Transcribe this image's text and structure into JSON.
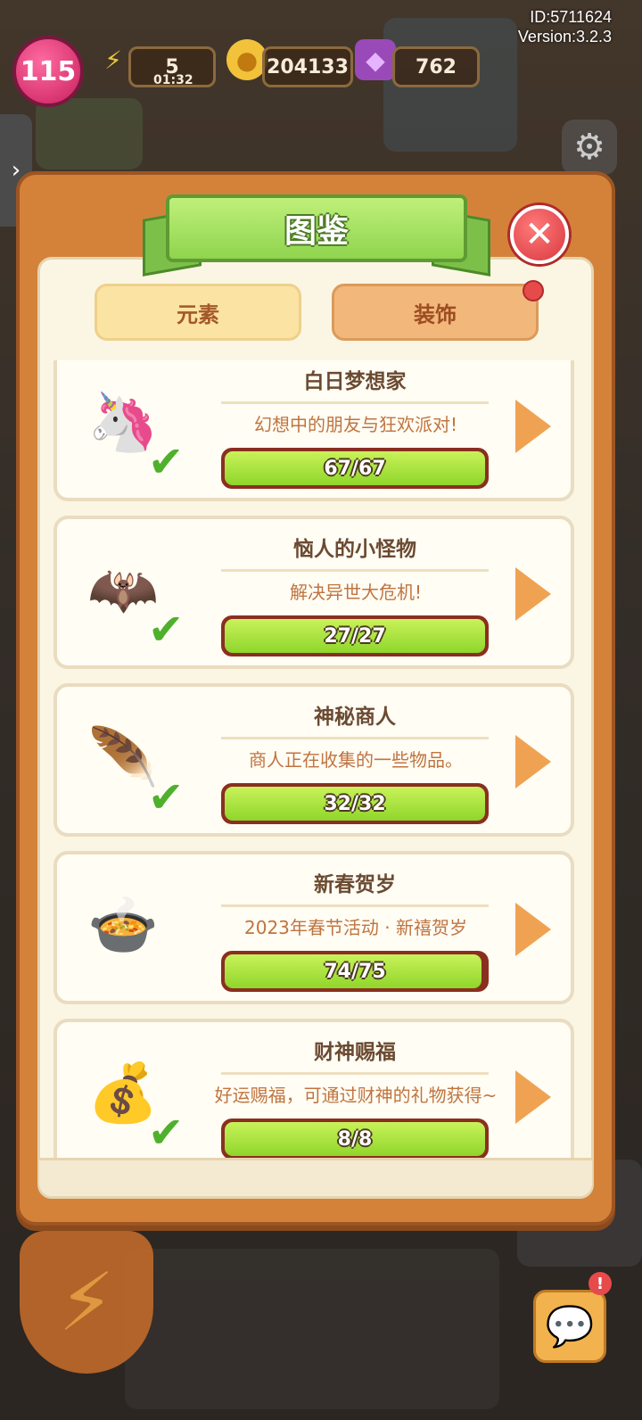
{
  "hud": {
    "id_text": "ID:5711624",
    "version_text": "Version:3.2.3",
    "level": "115",
    "energy": "5",
    "energy_timer": "01:32",
    "coins": "204133",
    "gems": "762"
  },
  "side_tab_icon": "chevron-right-icon",
  "panel": {
    "title": "图鉴",
    "close_icon": "close-icon",
    "tabs": [
      {
        "label": "元素"
      },
      {
        "label": "装饰"
      }
    ]
  },
  "collections": [
    {
      "title": "白日梦想家",
      "desc": "幻想中的朋友与狂欢派对!",
      "progress": "67/67",
      "fraction": 1.0,
      "complete": true,
      "icon": "unicorn-icon"
    },
    {
      "title": "恼人的小怪物",
      "desc": "解决异世大危机!",
      "progress": "27/27",
      "fraction": 1.0,
      "complete": true,
      "icon": "bat-icon"
    },
    {
      "title": "神秘商人",
      "desc": "商人正在收集的一些物品。",
      "progress": "32/32",
      "fraction": 1.0,
      "complete": true,
      "icon": "feather-icon"
    },
    {
      "title": "新春贺岁",
      "desc": "2023年春节活动 · 新禧贺岁",
      "progress": "74/75",
      "fraction": 0.987,
      "complete": false,
      "icon": "hotpot-table-icon"
    },
    {
      "title": "财神赐福",
      "desc": "好运赐福，可通过财神的礼物获得~",
      "progress": "8/8",
      "fraction": 1.0,
      "complete": true,
      "icon": "lucky-bag-icon"
    }
  ],
  "chat_badge": "!"
}
